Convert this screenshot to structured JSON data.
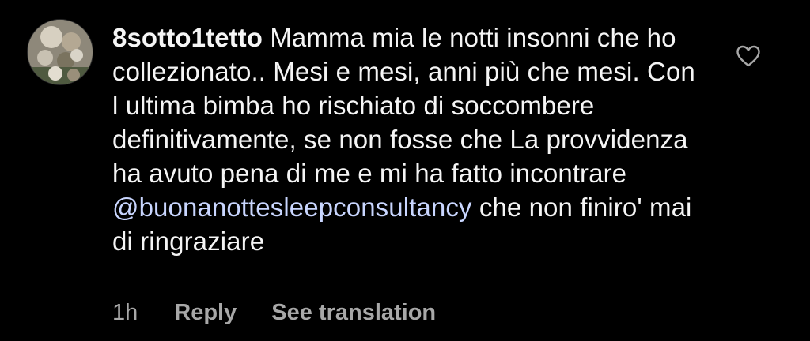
{
  "comment": {
    "username": "8sotto1tetto",
    "text_before_mention": "Mamma mia le notti insonni che ho collezionato.. Mesi e mesi, anni più che mesi. Con l ultima bimba ho rischiato di soccombere definitivamente, se non fosse che La provvidenza ha avuto pena di me e mi ha fatto incontrare",
    "mention": "@buonanottesleepconsultancy",
    "text_after_mention": "che non finiro' mai di ringraziare",
    "timestamp": "1h",
    "reply_label": "Reply",
    "translate_label": "See translation",
    "like_icon": "heart-outline-icon",
    "avatar_icon": "user-avatar-photo"
  },
  "colors": {
    "background": "#000000",
    "text": "#f5f5f5",
    "meta": "#a8a8a8",
    "mention": "#c9d6ff"
  }
}
